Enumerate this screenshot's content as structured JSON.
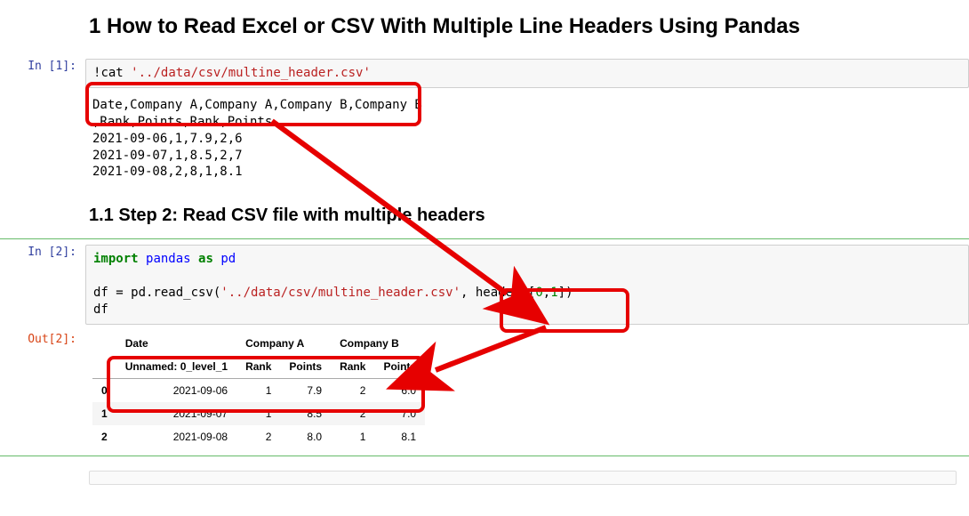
{
  "headings": {
    "h1": "1  How to Read Excel or CSV With Multiple Line Headers Using Pandas",
    "h2": "1.1  Step 2: Read CSV file with multiple headers"
  },
  "prompts": {
    "in1": "In [1]:",
    "in2": "In [2]:",
    "out2": "Out[2]:"
  },
  "code1": {
    "bang": "!",
    "cmd": "cat",
    "sp": " ",
    "str": "'../data/csv/multine_header.csv'"
  },
  "output1": {
    "lines": [
      "Date,Company A,Company A,Company B,Company B",
      ",Rank,Points,Rank,Points",
      "2021-09-06,1,7.9,2,6",
      "2021-09-07,1,8.5,2,7",
      "2021-09-08,2,8,1,8.1"
    ]
  },
  "code2": {
    "kw_import": "import",
    "mod": "pandas",
    "kw_as": "as",
    "alias": "pd",
    "blank": "",
    "assign": "df = pd.read_csv(",
    "str": "'../data/csv/multine_header.csv'",
    "comma_sp": ", ",
    "kw_header": "header",
    "eq": "=",
    "lbr": "[",
    "n0": "0",
    "comma": ",",
    "n1": "1",
    "rbr_paren": "])",
    "last": "df"
  },
  "table": {
    "top": [
      "",
      "Date",
      "Company A",
      "Company A",
      "Company B",
      "Company B"
    ],
    "sub": [
      "",
      "Unnamed: 0_level_1",
      "Rank",
      "Points",
      "Rank",
      "Points"
    ],
    "rows": [
      [
        "0",
        "2021-09-06",
        "1",
        "7.9",
        "2",
        "6.0"
      ],
      [
        "1",
        "2021-09-07",
        "1",
        "8.5",
        "2",
        "7.0"
      ],
      [
        "2",
        "2021-09-08",
        "2",
        "8.0",
        "1",
        "8.1"
      ]
    ]
  }
}
